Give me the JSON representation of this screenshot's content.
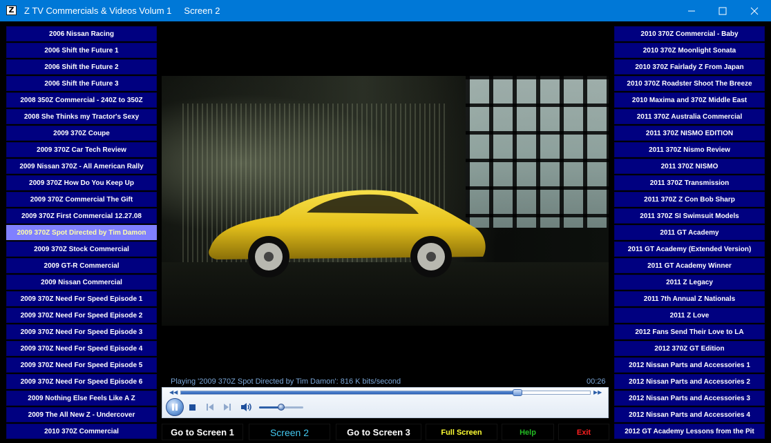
{
  "window": {
    "icon_letter": "Z",
    "title": "Z TV Commercials & Videos Volum 1     Screen 2"
  },
  "left_list": [
    "2006 Nissan Racing",
    "2006 Shift the Future 1",
    "2006 Shift the Future 2",
    "2006 Shift the Future 3",
    "2008 350Z Commercial - 240Z to 350Z",
    "2008 She Thinks my Tractor's Sexy",
    "2009 370Z Coupe",
    "2009 370Z Car Tech Review",
    "2009 Nissan 370Z - All American Rally",
    "2009 370Z How Do You Keep Up",
    "2009 370Z Commercial The Gift",
    "2009 370Z First Commercial 12.27.08",
    "2009 370Z Spot Directed by Tim Damon",
    "2009 370Z Stock Commercial",
    "2009 GT-R Commercial",
    "2009 Nissan Commercial",
    "2009 370Z Need For Speed Episode 1",
    "2009 370Z Need For Speed Episode 2",
    "2009 370Z Need For Speed Episode 3",
    "2009 370Z Need For Speed Episode 4",
    "2009 370Z Need For Speed Episode 5",
    "2009 370Z Need For Speed Episode 6",
    "2009 Nothing Else Feels Like A Z",
    "2009 The All New Z - Undercover",
    "2010 370Z Commercial"
  ],
  "left_selected_index": 12,
  "right_list": [
    "2010 370Z Commercial - Baby",
    "2010 370Z Moonlight Sonata",
    "2010 370Z Fairlady Z From Japan",
    "2010 370Z Roadster Shoot The Breeze",
    "2010 Maxima and 370Z Middle East",
    "2011 370Z Australia Commercial",
    "2011 370Z NISMO EDITION",
    "2011 370Z Nismo Review",
    "2011 370Z NISMO",
    "2011 370Z Transmission",
    "2011 370Z Z Con Bob Sharp",
    "2011 370Z SI Swimsuit Models",
    "2011 GT Academy",
    "2011 GT Academy (Extended Version)",
    "2011 GT Academy Winner",
    "2011 Z Legacy",
    "2011 7th Annual Z Nationals",
    "2011 Z Love",
    "2012 Fans Send Their Love to LA",
    "2012 370Z GT Edition",
    "2012 Nissan Parts and Accessories 1",
    "2012 Nissan Parts and Accessories 2",
    "2012 Nissan Parts and Accessories 3",
    "2012 Nissan Parts and Accessories 4",
    "2012 GT Academy Lessons from the Pit"
  ],
  "player": {
    "status": "Playing '2009 370Z Spot Directed by Tim Damon': 816 K bits/second",
    "time": "00:26",
    "seek_progress": 0.82,
    "volume_level": 0.5
  },
  "nav": {
    "screen1": "Go to Screen 1",
    "screen2": "Screen 2",
    "screen3": "Go to Screen 3",
    "full_screen": "Full Screen",
    "help": "Help",
    "exit": "Exit"
  },
  "colors": {
    "list_bg": "#000080",
    "list_selected_bg": "#8080ff",
    "titlebar": "#0078d7"
  }
}
